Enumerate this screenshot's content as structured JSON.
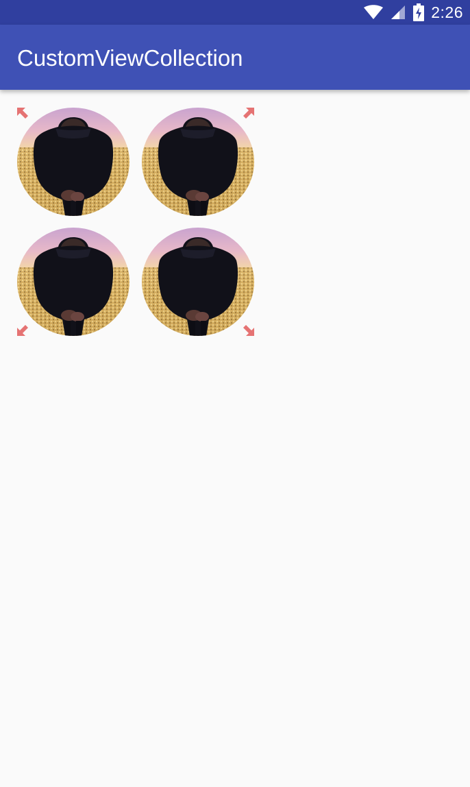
{
  "status_bar": {
    "time": "2:26",
    "icons": [
      "wifi-icon",
      "cell-signal-icon",
      "battery-charging-icon"
    ]
  },
  "app_bar": {
    "title": "CustomViewCollection"
  },
  "grid": {
    "columns": 2,
    "rows": 2,
    "corner_icon": "expand-arrow-icon",
    "corner_color": "#e57373"
  },
  "colors": {
    "status_bar": "#303f9f",
    "app_bar": "#3f51b5",
    "background": "#fafafa"
  }
}
